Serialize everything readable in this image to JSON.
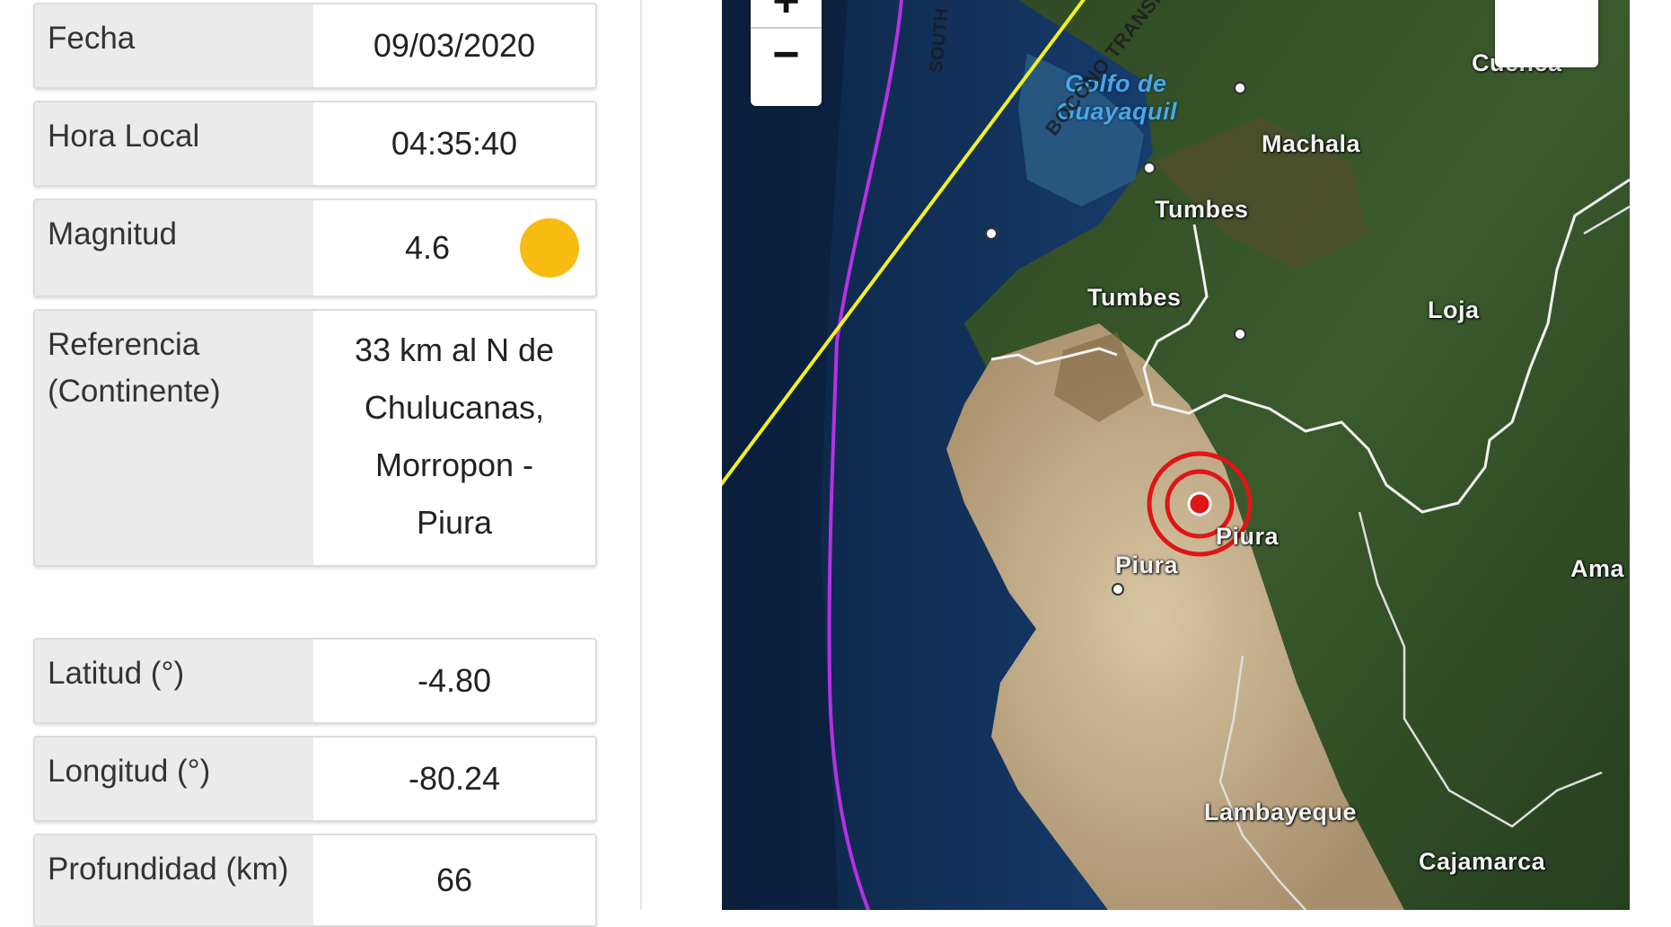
{
  "info": {
    "fecha": {
      "label": "Fecha",
      "value": "09/03/2020"
    },
    "hora": {
      "label": "Hora Local",
      "value": "04:35:40"
    },
    "magnitud": {
      "label": "Magnitud",
      "value": "4.6",
      "color": "#f8bb12"
    },
    "referencia": {
      "label_line1": "Referencia",
      "label_line2": "(Continente)",
      "value_lines": [
        "33 km al N de",
        "Chulucanas,",
        "Morropon -",
        "Piura"
      ]
    },
    "latitud": {
      "label": "Latitud (°)",
      "value": "-4.80"
    },
    "longitud": {
      "label": "Longitud (°)",
      "value": "-80.24"
    },
    "profundidad": {
      "label": "Profundidad (km)",
      "value": "66"
    }
  },
  "map": {
    "zoom_in": "+",
    "zoom_out": "−",
    "labels": {
      "golfo_line1": "Golfo de",
      "golfo_line2": "Guayaquil",
      "machala": "Machala",
      "tumbes_city": "Tumbes",
      "tumbes_region": "Tumbes",
      "loja": "Loja",
      "cuenca": "Cuenca",
      "piura_region": "Piura",
      "piura_city": "Piura",
      "lambayeque": "Lambayeque",
      "cajamarca": "Cajamarca",
      "amazonas": "Ama",
      "bocono": "BOCONO TRANSFORM FA",
      "south": "SOUTH"
    },
    "epicenter_color": "#e01515",
    "trench_color": "#b431e6",
    "fault_color": "#f4f01e"
  }
}
